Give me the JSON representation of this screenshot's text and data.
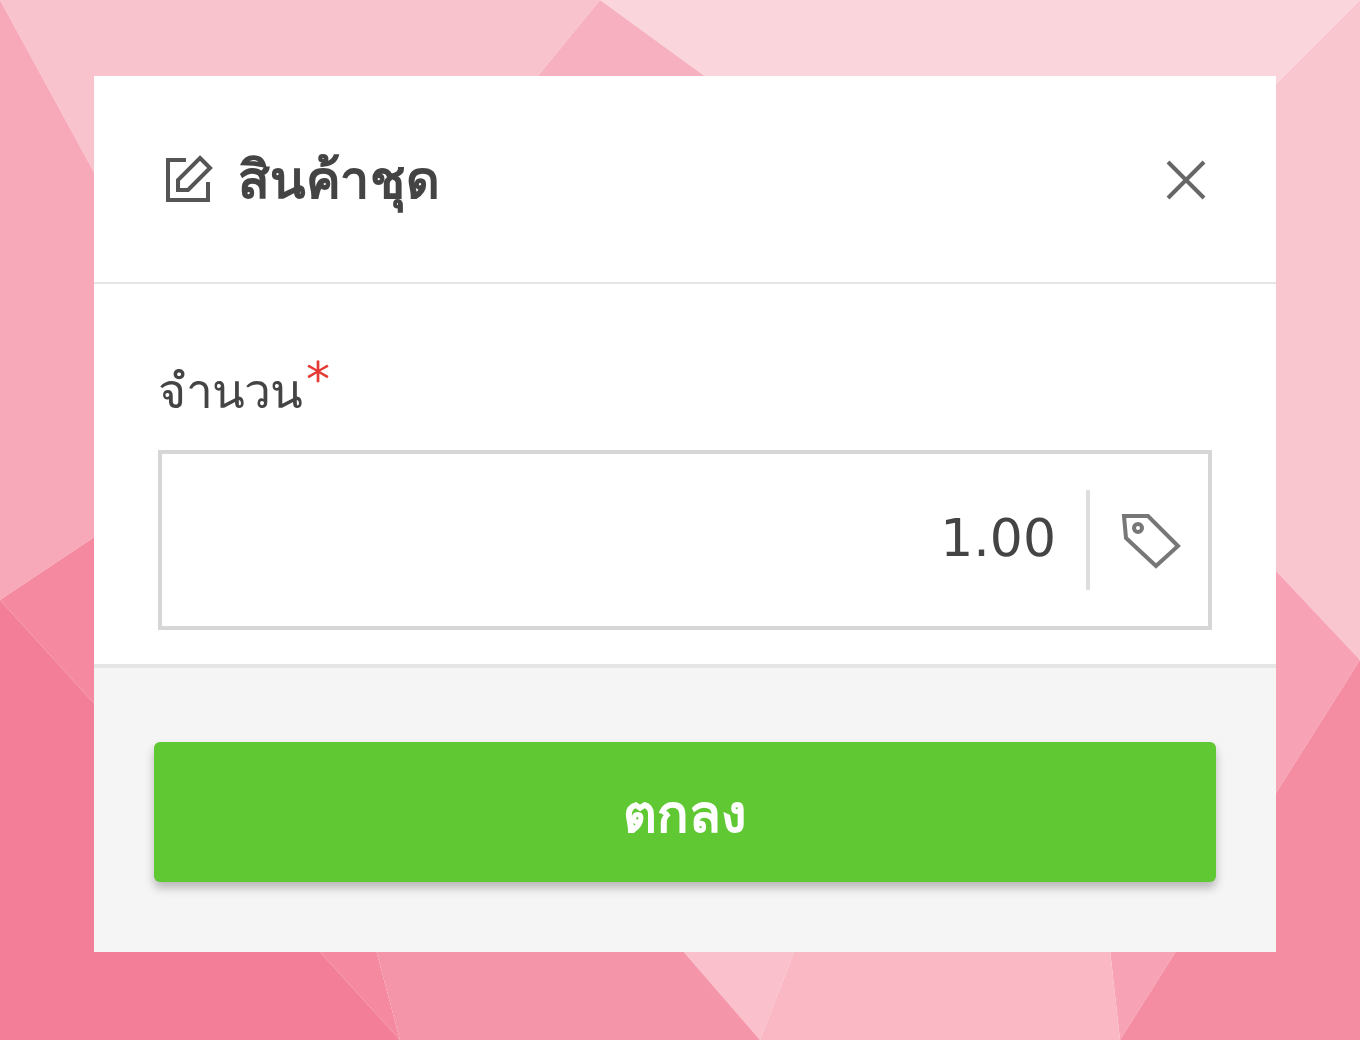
{
  "dialog": {
    "title": "สินค้าชุด",
    "field": {
      "label": "จำนวน",
      "required_mark": "*",
      "value": "1.00"
    },
    "buttons": [
      "ตกลง"
    ]
  }
}
